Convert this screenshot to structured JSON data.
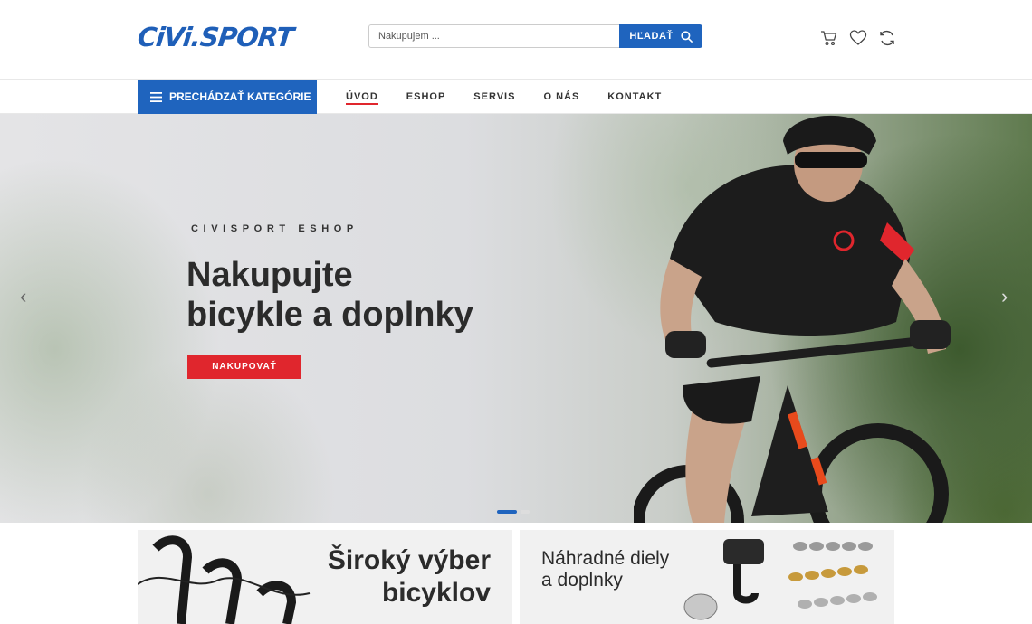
{
  "header": {
    "logo_text": "CiVi.SPORT",
    "search": {
      "placeholder": "Nakupujem ...",
      "button_label": "HĽADAŤ"
    },
    "icons": [
      "cart-icon",
      "heart-icon",
      "compare-icon"
    ]
  },
  "nav": {
    "categories_label": "PRECHÁDZAŤ KATEGÓRIE",
    "items": [
      {
        "label": "ÚVOD",
        "active": true
      },
      {
        "label": "ESHOP",
        "active": false
      },
      {
        "label": "SERVIS",
        "active": false
      },
      {
        "label": "O NÁS",
        "active": false
      },
      {
        "label": "KONTAKT",
        "active": false
      }
    ]
  },
  "hero": {
    "subtitle": "CIVISPORT ESHOP",
    "title": "Nakupujte\nbicykle a doplnky",
    "button_label": "NAKUPOVAŤ",
    "slide_count": 2,
    "active_slide": 1
  },
  "banners": {
    "left": {
      "title_line1": "Široký výber",
      "title_line2": "bicyklov"
    },
    "right": {
      "title_line1": "Náhradné diely",
      "title_line2": "a doplnky"
    }
  },
  "colors": {
    "brand_blue": "#1f64be",
    "accent_red": "#e0262d"
  }
}
